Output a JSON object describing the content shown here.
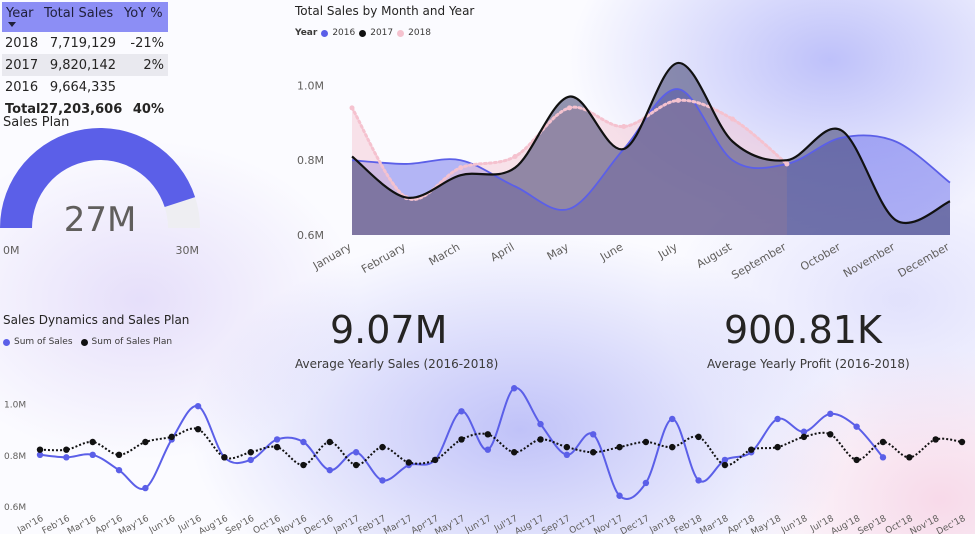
{
  "table": {
    "headers": [
      "Year",
      "Total Sales",
      "YoY %"
    ],
    "rows": [
      {
        "year": "2018",
        "sales": "7,719,129",
        "yoy": "-21%"
      },
      {
        "year": "2017",
        "sales": "9,820,142",
        "yoy": "2%"
      },
      {
        "year": "2016",
        "sales": "9,664,335",
        "yoy": ""
      }
    ],
    "total": {
      "label": "Total",
      "sales": "27,203,606",
      "yoy": "40%"
    }
  },
  "gauge": {
    "title": "Sales Plan",
    "value_label": "27M",
    "min_label": "0M",
    "max_label": "30M",
    "value": 27,
    "min": 0,
    "max": 30,
    "color": "#5b5fe8"
  },
  "kpis": [
    {
      "value": "9.07M",
      "label": "Average Yearly Sales (2016-2018)"
    },
    {
      "value": "900.81K",
      "label": "Average Yearly Profit (2016-2018)"
    }
  ],
  "chart_data": [
    {
      "type": "area",
      "title": "Total Sales by Month and Year",
      "legend_title": "Year",
      "legend_position": "top-left",
      "categories": [
        "January",
        "February",
        "March",
        "April",
        "May",
        "June",
        "July",
        "August",
        "September",
        "October",
        "November",
        "December"
      ],
      "y_tick_labels": [
        "0.6M",
        "0.8M",
        "1.0M"
      ],
      "y_ticks": [
        0.6,
        0.8,
        1.0
      ],
      "ylim": [
        0.6,
        1.1
      ],
      "series": [
        {
          "name": "2016",
          "color": "#5b5fe8",
          "values": [
            0.8,
            0.79,
            0.8,
            0.73,
            0.67,
            0.83,
            0.99,
            0.8,
            0.79,
            0.86,
            0.85,
            0.74
          ]
        },
        {
          "name": "2017",
          "color": "#111111",
          "values": [
            0.81,
            0.7,
            0.76,
            0.78,
            0.97,
            0.83,
            1.06,
            0.85,
            0.8,
            0.88,
            0.64,
            0.69
          ]
        },
        {
          "name": "2018",
          "color": "#f5c2cf",
          "values": [
            0.94,
            0.7,
            0.78,
            0.81,
            0.94,
            0.89,
            0.96,
            0.91,
            0.79
          ]
        }
      ]
    },
    {
      "type": "line",
      "title": "Sales Dynamics and Sales Plan",
      "legend_position": "top-left",
      "categories": [
        "Jan'16",
        "Feb'16",
        "Mar'16",
        "Apr'16",
        "May'16",
        "Jun'16",
        "Jul'16",
        "Aug'16",
        "Sep'16",
        "Oct'16",
        "Nov'16",
        "Dec'16",
        "Jan'17",
        "Feb'17",
        "Mar'17",
        "Apr'17",
        "May'17",
        "Jun'17",
        "Jul'17",
        "Aug'17",
        "Sep'17",
        "Oct'17",
        "Nov'17",
        "Dec'17",
        "Jan'18",
        "Feb'18",
        "Mar'18",
        "Apr'18",
        "May'18",
        "Jun'18",
        "Jul'18",
        "Aug'18",
        "Sep'18",
        "Oct'18",
        "Nov'18",
        "Dec'18"
      ],
      "y_tick_labels": [
        "0.6M",
        "0.8M",
        "1.0M"
      ],
      "y_ticks": [
        0.6,
        0.8,
        1.0
      ],
      "ylim": [
        0.6,
        1.1
      ],
      "series": [
        {
          "name": "Sum of Sales",
          "color": "#5b5fe8",
          "style": "solid",
          "values": [
            0.8,
            0.79,
            0.8,
            0.74,
            0.67,
            0.86,
            0.99,
            0.79,
            0.78,
            0.86,
            0.85,
            0.74,
            0.81,
            0.7,
            0.76,
            0.78,
            0.97,
            0.82,
            1.06,
            0.92,
            0.8,
            0.88,
            0.64,
            0.69,
            0.94,
            0.7,
            0.78,
            0.81,
            0.94,
            0.89,
            0.96,
            0.91,
            0.79
          ]
        },
        {
          "name": "Sum of Sales Plan",
          "color": "#111111",
          "style": "dotted",
          "values": [
            0.82,
            0.82,
            0.85,
            0.8,
            0.85,
            0.87,
            0.9,
            0.79,
            0.81,
            0.83,
            0.76,
            0.85,
            0.76,
            0.83,
            0.77,
            0.78,
            0.86,
            0.88,
            0.81,
            0.86,
            0.83,
            0.81,
            0.83,
            0.85,
            0.83,
            0.87,
            0.76,
            0.82,
            0.83,
            0.87,
            0.88,
            0.78,
            0.85,
            0.79,
            0.86,
            0.85
          ]
        }
      ]
    }
  ]
}
